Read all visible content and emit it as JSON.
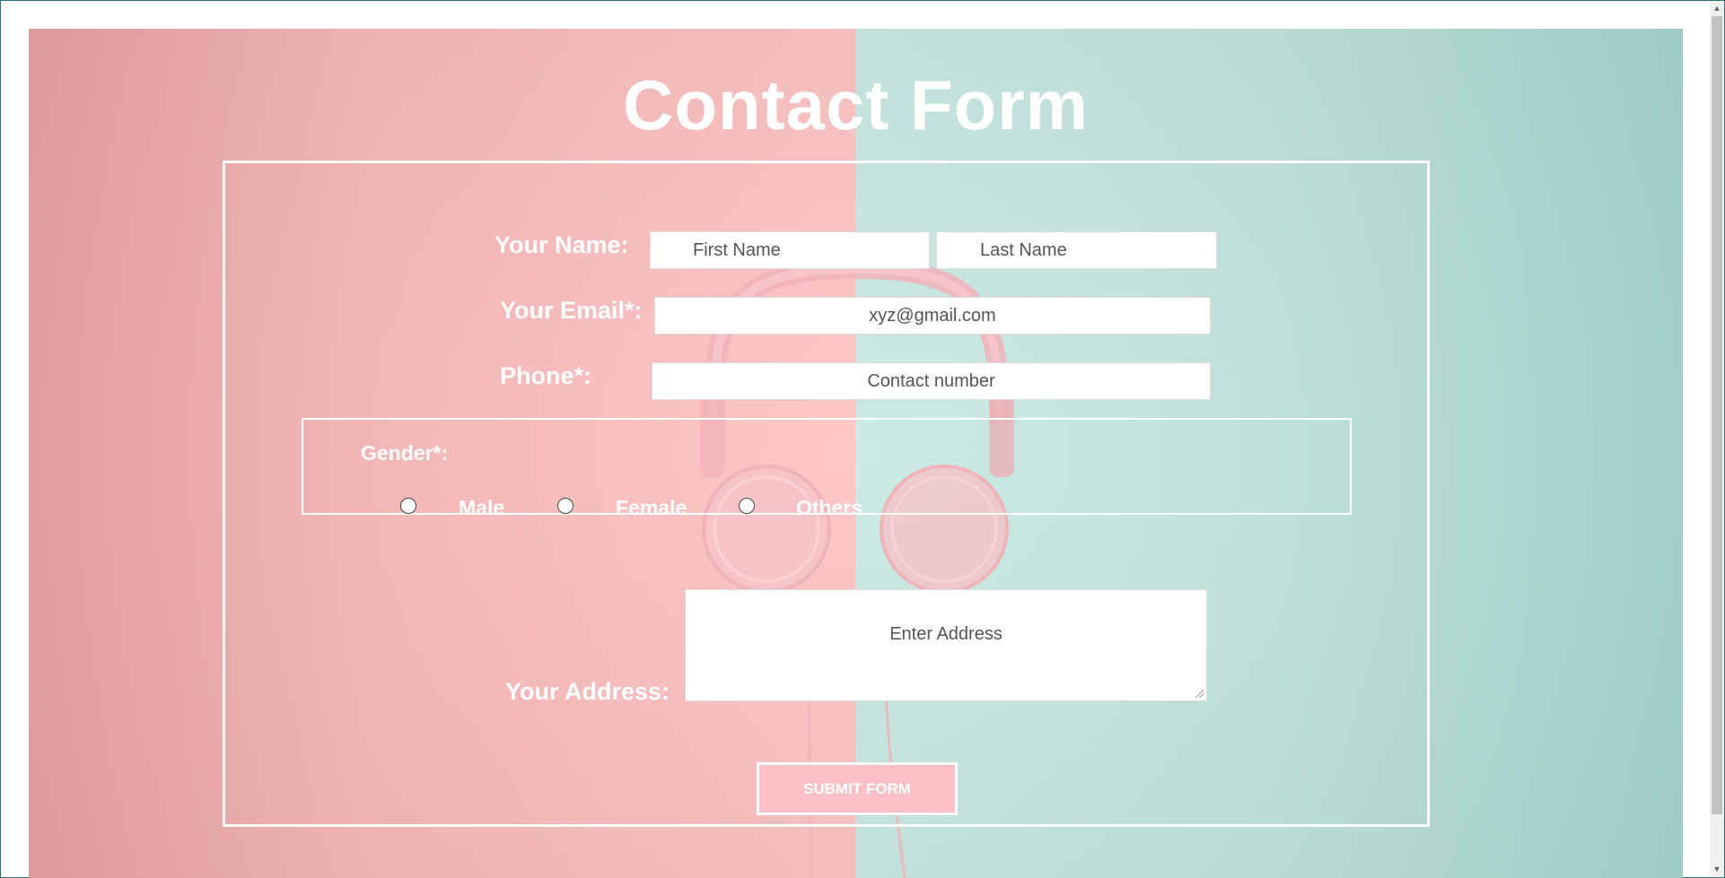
{
  "page": {
    "title": "Contact Form"
  },
  "form": {
    "name_label": "Your Name:",
    "first_name_placeholder": "First Name",
    "last_name_placeholder": "Last Name",
    "email_label": "Your Email*:",
    "email_placeholder": "xyz@gmail.com",
    "phone_label": "Phone*:",
    "phone_placeholder": "Contact number",
    "gender": {
      "legend": "Gender*:",
      "options": [
        "Male",
        "Female",
        "Others"
      ]
    },
    "address_label": "Your Address:",
    "address_placeholder": "Enter Address",
    "submit_label": "SUBMIT FORM"
  },
  "colors": {
    "pink_background": "#fcc4c3",
    "teal_background": "#c9e9e3",
    "submit_button": "#fbbfc6",
    "text": "#ffffff"
  },
  "icons": {
    "scroll_up": "triangle-up-icon",
    "scroll_down": "triangle-down-icon",
    "decoration": "headphones-image"
  }
}
